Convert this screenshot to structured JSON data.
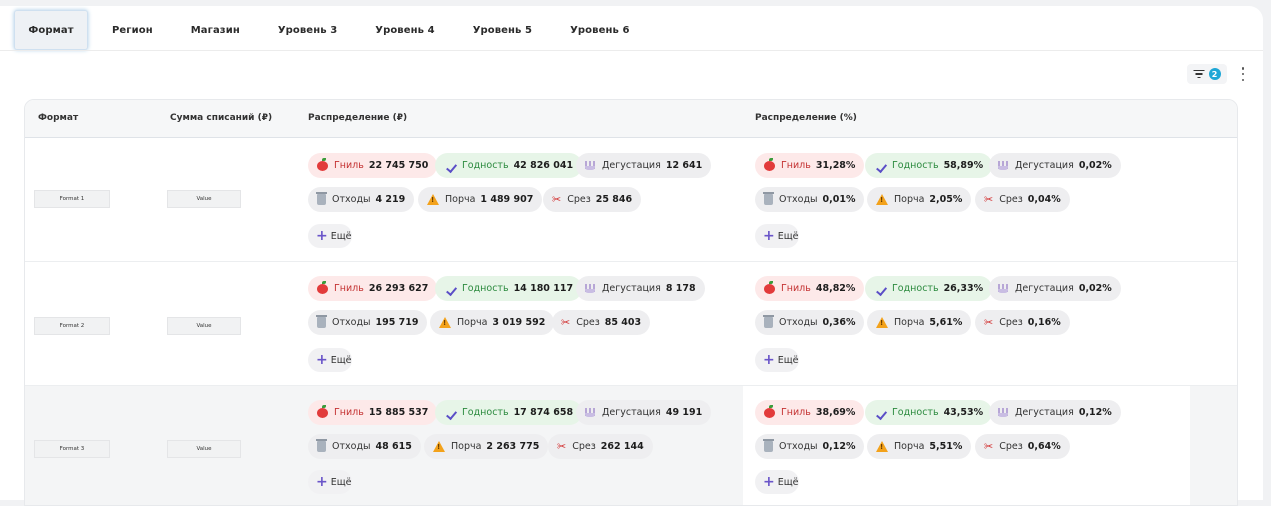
{
  "tabs": [
    "Формат",
    "Регион",
    "Магазин",
    "Уровень 3",
    "Уровень 4",
    "Уровень 5",
    "Уровень 6"
  ],
  "filter": {
    "count": "2"
  },
  "columns": {
    "format": "Формат",
    "sum": "Сумма списаний (₽)",
    "dist_rub": "Распределение (₽)",
    "dist_pct": "Распределение (%)"
  },
  "labels": {
    "rot": "Гниль",
    "fit": "Годность",
    "taste": "Дегустация",
    "waste": "Отходы",
    "spoil": "Порча",
    "cut": "Срез",
    "more": "Ещё"
  },
  "rows": [
    {
      "format": "Format 1",
      "sum": "Value",
      "rub": {
        "rot": "22 745 750",
        "fit": "42 826 041",
        "taste": "12 641",
        "waste": "4 219",
        "spoil": "1 489 907",
        "cut": "25 846"
      },
      "pct": {
        "rot": "31,28%",
        "fit": "58,89%",
        "taste": "0,02%",
        "waste": "0,01%",
        "spoil": "2,05%",
        "cut": "0,04%"
      }
    },
    {
      "format": "Format 2",
      "sum": "Value",
      "rub": {
        "rot": "26 293 627",
        "fit": "14 180 117",
        "taste": "8 178",
        "waste": "195 719",
        "spoil": "3 019 592",
        "cut": "85 403"
      },
      "pct": {
        "rot": "48,82%",
        "fit": "26,33%",
        "taste": "0,02%",
        "waste": "0,36%",
        "spoil": "5,61%",
        "cut": "0,16%"
      }
    },
    {
      "format": "Format 3",
      "sum": "Value",
      "rub": {
        "rot": "15 885 537",
        "fit": "17 874 658",
        "taste": "49 191",
        "waste": "48 615",
        "spoil": "2 263 775",
        "cut": "262 144"
      },
      "pct": {
        "rot": "38,69%",
        "fit": "43,53%",
        "taste": "0,12%",
        "waste": "0,12%",
        "spoil": "5,51%",
        "cut": "0,64%"
      }
    }
  ]
}
